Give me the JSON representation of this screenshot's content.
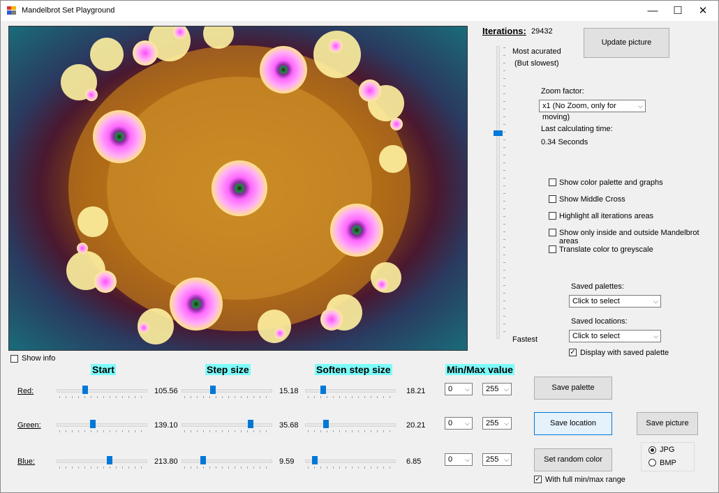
{
  "window": {
    "title": "Mandelbrot Set Playground",
    "minimize": "—",
    "maximize": "☐",
    "close": "✕"
  },
  "iterations": {
    "label": "Iterations:",
    "value": "29432"
  },
  "update_button": "Update picture",
  "quality": {
    "top": "Most acurated",
    "top_sub": "(But slowest)",
    "bottom": "Fastest"
  },
  "zoom": {
    "label": "Zoom factor:",
    "value": "x1 (No Zoom, only for moving)"
  },
  "calc_time": {
    "label": "Last calculating time:",
    "value": "0.34 Seconds"
  },
  "options": [
    {
      "label": "Show color palette and graphs",
      "checked": false
    },
    {
      "label": "Show Middle Cross",
      "checked": false
    },
    {
      "label": "Highlight all iterations areas",
      "checked": false
    },
    {
      "label": "Show only inside and outside Mandelbrot areas",
      "checked": false
    },
    {
      "label": "Translate color to greyscale",
      "checked": false
    }
  ],
  "saved_palettes": {
    "label": "Saved palettes:",
    "value": "Click to select"
  },
  "saved_locations": {
    "label": "Saved locations:",
    "value": "Click to select"
  },
  "display_saved_palette": {
    "label": "Display with saved palette",
    "checked": true
  },
  "show_info": {
    "label": "Show info",
    "checked": false
  },
  "headers": {
    "start": "Start",
    "step": "Step size",
    "soften": "Soften step size",
    "minmax": "Min/Max value"
  },
  "rows": [
    {
      "label": "Red:",
      "start": "105.56",
      "step": "15.18",
      "soften": "18.21",
      "min": "0",
      "max": "255",
      "start_pos": 0.3,
      "step_pos": 0.34,
      "soften_pos": 0.18
    },
    {
      "label": "Green:",
      "start": "139.10",
      "step": "35.68",
      "soften": "20.21",
      "min": "0",
      "max": "255",
      "start_pos": 0.39,
      "step_pos": 0.78,
      "soften_pos": 0.21
    },
    {
      "label": "Blue:",
      "start": "213.80",
      "step": "9.59",
      "soften": "6.85",
      "min": "0",
      "max": "255",
      "start_pos": 0.59,
      "step_pos": 0.22,
      "soften_pos": 0.08
    }
  ],
  "buttons": {
    "save_palette": "Save  palette",
    "save_location": "Save location",
    "save_picture": "Save picture",
    "random_color": "Set random color"
  },
  "full_range": {
    "label": "With full min/max range",
    "checked": true
  },
  "format": {
    "jpg": "JPG",
    "bmp": "BMP",
    "selected": "JPG"
  },
  "quality_slider_level": 0.29,
  "colors": {
    "header_bg": "#7dfbfb",
    "accent": "#0078d7"
  }
}
